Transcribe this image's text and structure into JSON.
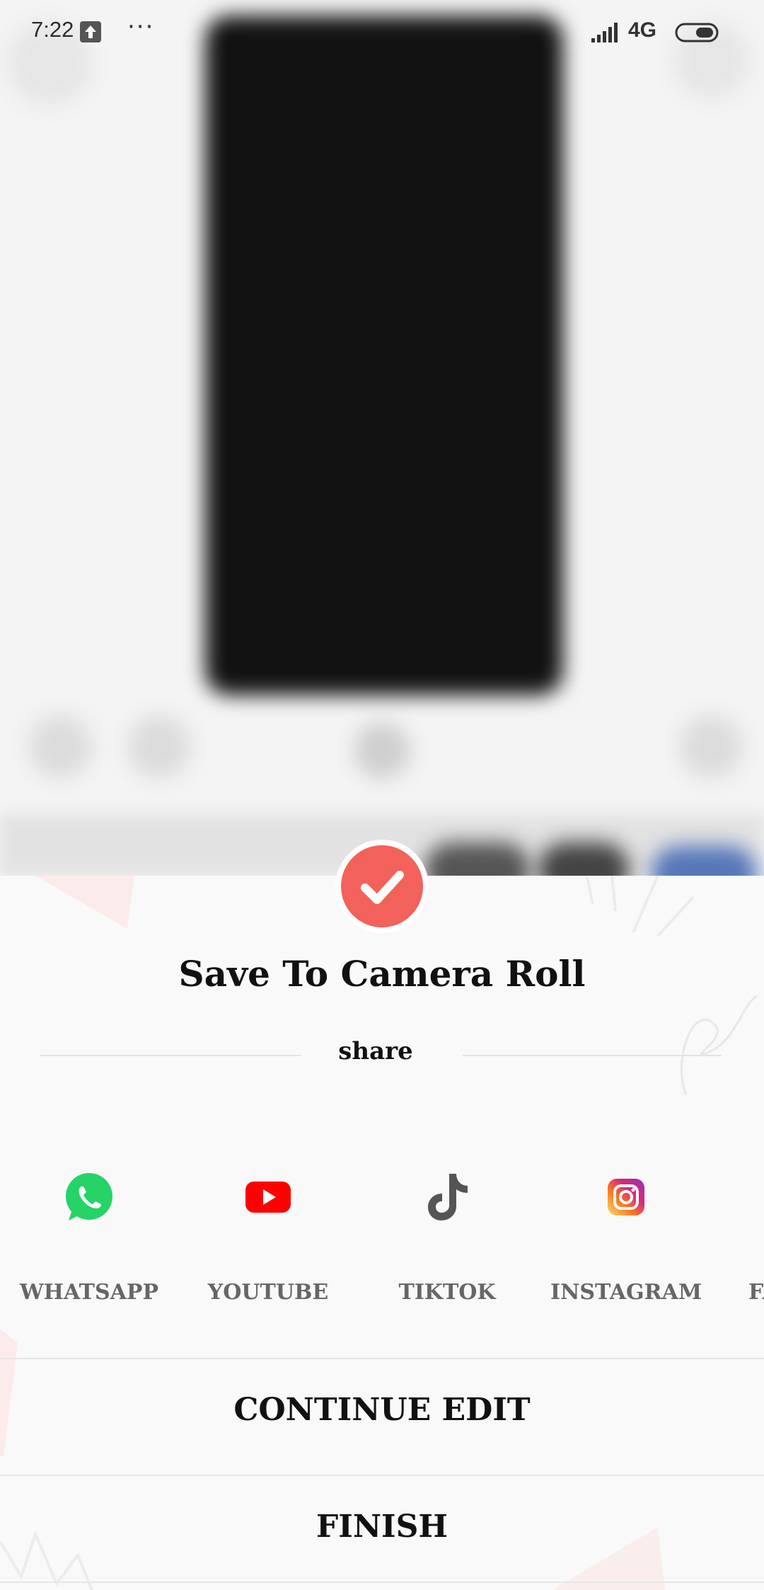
{
  "status_bar": {
    "time": "7:22",
    "overflow": "···",
    "network": "4G"
  },
  "dialog": {
    "title": "Save To Camera Roll",
    "share_label": "share"
  },
  "share_apps": [
    {
      "label": "WHATSAPP",
      "icon": "whatsapp-icon",
      "color": "#25d366"
    },
    {
      "label": "YOUTUBE",
      "icon": "youtube-icon",
      "color": "#ff0000"
    },
    {
      "label": "TIKTOK",
      "icon": "tiktok-icon",
      "color": "#555555"
    },
    {
      "label": "INSTAGRAM",
      "icon": "instagram-icon",
      "color": "#e1306c"
    },
    {
      "label": "FA",
      "icon": "facebook-icon",
      "color": "#1877f2"
    }
  ],
  "actions": {
    "continue_edit": "CONTINUE EDIT",
    "finish": "FINISH"
  },
  "colors": {
    "accent": "#f2625a",
    "background": "#f9f9f9"
  }
}
